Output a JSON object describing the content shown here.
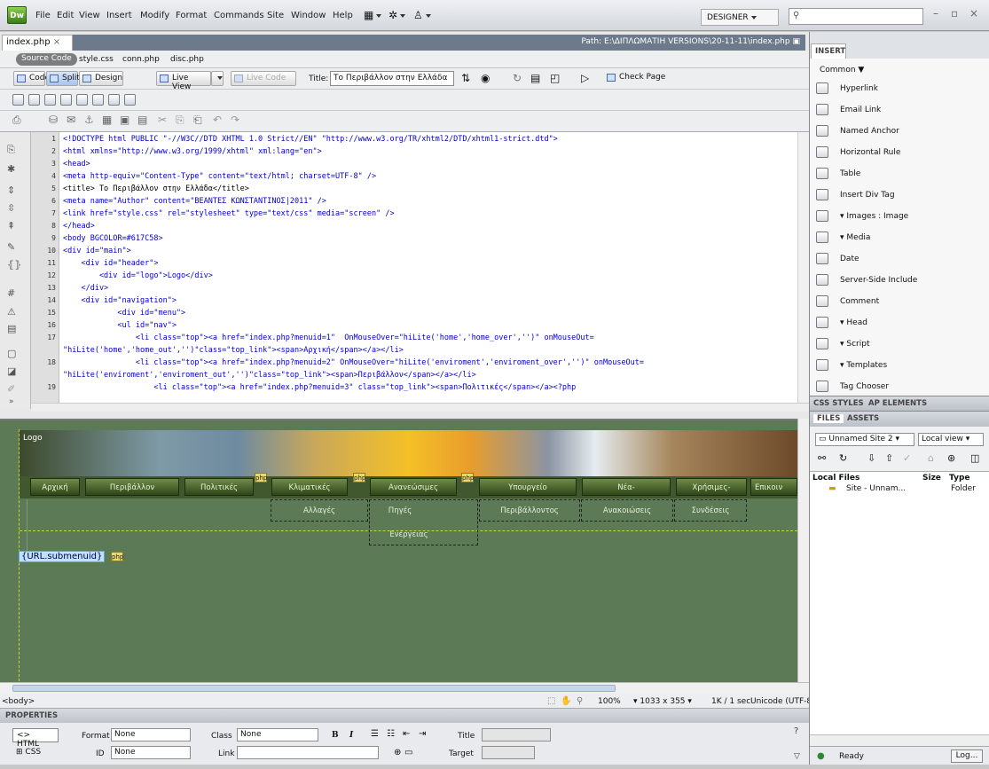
{
  "app": {
    "logo": "Dw",
    "menus": [
      "File",
      "Edit",
      "View",
      "Insert",
      "Modify",
      "Format",
      "Commands",
      "Site",
      "Window",
      "Help"
    ],
    "workspace": "DESIGNER",
    "search_placeholder": "",
    "window_controls": [
      "–",
      "▫",
      "×"
    ]
  },
  "document": {
    "tab": "index.php",
    "path": "Path: E:\\ΔΙΠΛΩΜΑΤΙΗ VERSIONS\\20-11-11\\index.php",
    "source_code": "Source Code",
    "related_files": [
      "style.css",
      "conn.php",
      "disc.php"
    ]
  },
  "toolbar": {
    "code": "Code",
    "split": "Split",
    "design": "Design",
    "live_view": "Live View",
    "live_code": "Live Code",
    "title_label": "Title:",
    "title_value": "Το Περιβάλλον στην Ελλάδα",
    "check_page": "Check Page"
  },
  "code": {
    "line_numbers": [
      "1",
      "2",
      "3",
      "4",
      "5",
      "6",
      "7",
      "8",
      "9",
      "10",
      "11",
      "12",
      "13",
      "14",
      "15",
      "16",
      "17",
      "",
      "18",
      "",
      "19"
    ],
    "lines": [
      "<!DOCTYPE html PUBLIC \"-//W3C//DTD XHTML 1.0 Strict//EN\" \"http://www.w3.org/TR/xhtml2/DTD/xhtml1-strict.dtd\">",
      "<html xmlns=\"http://www.w3.org/1999/xhtml\" xml:lang=\"en\">",
      "<head>",
      "<meta http-equiv=\"Content-Type\" content=\"text/html; charset=UTF-8\" />",
      "<title> Το Περιβάλλον στην Ελλάδα</title>",
      "<meta name=\"Author\" content=\"ΒΕΑΝΤΕΣ ΚΩΝΣΤΑΝΤΙΝΟΣ|2011\" />",
      "<link href=\"style.css\" rel=\"stylesheet\" type=\"text/css\" media=\"screen\" />",
      "</head>",
      "<body BGCOLOR=#617C58>",
      "<div id=\"main\">",
      "    <div id=\"header\">",
      "        <div id=\"logo\">Logo</div>",
      "    </div>",
      "    <div id=\"navigation\">",
      "            <div id=\"menu\">",
      "            <ul id=\"nav\">",
      "                <li class=\"top\"><a href=\"index.php?menuid=1\"  OnMouseOver=\"hiLite('home','home_over','')\" onMouseOut=",
      "\"hiLite('home','home_out','')\"class=\"top_link\"><span>Αρχική</span></a></li>",
      "                <li class=\"top\"><a href=\"index.php?menuid=2\" OnMouseOver=\"hiLite('enviroment','enviroment_over','')\" onMouseOut=",
      "\"hiLite('enviroment','enviroment_out','')\"class=\"top_link\"><span>Περιβάλλον</span></a></li>",
      "                    <li class=\"top\"><a href=\"index.php?menuid=3\" class=\"top_link\"><span>Πολιτικές</span></a><?php"
    ]
  },
  "design": {
    "logo": "Logo",
    "nav": [
      "Αρχική",
      "Περιβάλλον",
      "Πολιτικές",
      "Κλιματικές",
      "Ανανεώσιμες",
      "Υπουργείο",
      "Νέα-",
      "Χρήσιμες-",
      "Επικοιν"
    ],
    "sub": [
      "Αλλαγές",
      "Πηγές",
      "Περιβάλλοντος",
      "Ανακοιώσεις",
      "Συνδέσεις",
      "Ενέργειας"
    ],
    "url_tag": "{URL.submenuid}",
    "php": "php"
  },
  "status": {
    "tag": "<body>",
    "zoom": "100%",
    "size": "1033 x 355",
    "speed": "1K / 1 sec",
    "encoding": "Unicode (UTF-8)"
  },
  "properties": {
    "title": "PROPERTIES",
    "html_btn": "HTML",
    "css_btn": "CSS",
    "format_label": "Format",
    "format_value": "None",
    "id_label": "ID",
    "id_value": "None",
    "class_label": "Class",
    "class_value": "None",
    "link_label": "Link",
    "title_label": "Title",
    "target_label": "Target",
    "bold": "B",
    "italic": "I"
  },
  "insert": {
    "tab": "INSERT",
    "category": "Common",
    "items": [
      "Hyperlink",
      "Email Link",
      "Named Anchor",
      "Horizontal Rule",
      "Table",
      "Insert Div Tag",
      "Images : Image",
      "Media",
      "Date",
      "Server-Side Include",
      "Comment",
      "Head",
      "Script",
      "Templates",
      "Tag Chooser"
    ]
  },
  "panels": {
    "css_styles": "CSS STYLES",
    "ap_elements": "AP ELEMENTS",
    "files": "FILES",
    "assets": "ASSETS",
    "site": "Unnamed Site 2",
    "view": "Local view",
    "col_local": "Local Files",
    "col_size": "Size",
    "col_type": "Type",
    "site_row": "Site - Unnam...",
    "site_type": "Folder",
    "ready": "Ready",
    "log": "Log..."
  }
}
